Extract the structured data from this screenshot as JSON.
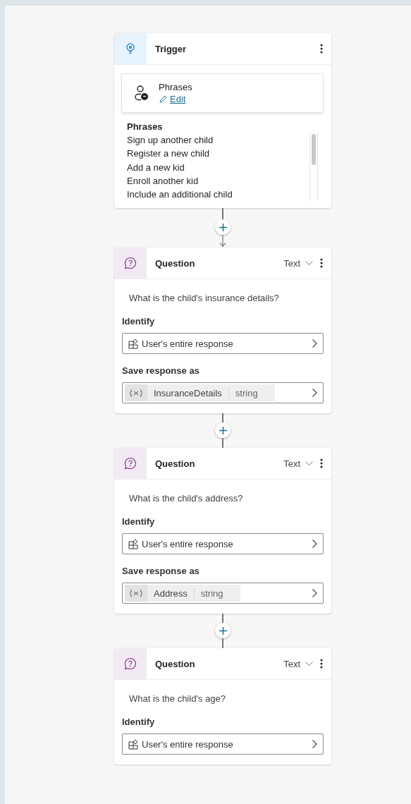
{
  "trigger": {
    "title": "Trigger",
    "source": {
      "title": "Phrases",
      "edit_link": "Edit"
    },
    "phrases_heading": "Phrases",
    "phrases": [
      "Sign up another child",
      "Register a new child",
      "Add a new kid",
      "Enroll another kid",
      "Include an additional child"
    ]
  },
  "nodes": [
    {
      "kind": "question",
      "arrow": true,
      "title": "Question",
      "type_label": "Text",
      "prompt": "What is the child's insurance details?",
      "identify_label": "Identify",
      "identify_value": "User's entire response",
      "save_label": "Save response as",
      "variable": {
        "name": "InsuranceDetails",
        "type": "string"
      }
    },
    {
      "kind": "question",
      "arrow": false,
      "title": "Question",
      "type_label": "Text",
      "prompt": "What is the child's address?",
      "identify_label": "Identify",
      "identify_value": "User's entire response",
      "save_label": "Save response as",
      "variable": {
        "name": "Address",
        "type": "string"
      }
    },
    {
      "kind": "question",
      "arrow": false,
      "title": "Question",
      "type_label": "Text",
      "prompt": "What is the child's age?",
      "identify_label": "Identify",
      "identify_value": "User's entire response"
    }
  ]
}
